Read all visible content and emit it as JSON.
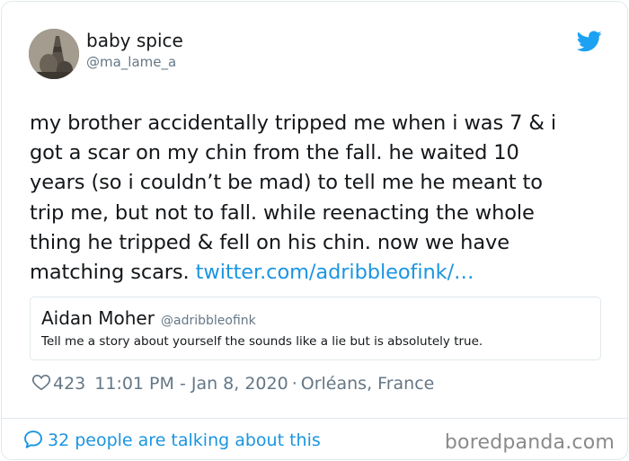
{
  "colors": {
    "twitter_blue": "#1da1f2",
    "link_blue": "#1b95e0",
    "secondary_text": "#657786",
    "border": "#e1e8ed"
  },
  "author": {
    "display_name": "baby spice",
    "handle": "@ma_lame_a",
    "avatar_icon": "avatar-photo",
    "platform_icon": "twitter-bird-icon"
  },
  "tweet": {
    "lines": [
      "my brother accidentally tripped me when i was 7 & i",
      "got a scar on my chin from the fall. he waited 10",
      "years (so i couldn’t be mad) to tell me he meant to",
      "trip me, but not to fall. while reenacting the whole",
      "thing he tripped & fell on his chin. now we have",
      "matching scars. "
    ],
    "link": "twitter.com/adribbleofink/…"
  },
  "quote": {
    "display_name": "Aidan Moher",
    "handle": "@adribbleofink",
    "text": "Tell me a story about yourself the sounds like a lie but is absolutely true."
  },
  "meta": {
    "like_icon": "heart-icon",
    "like_count": "423",
    "timestamp": "11:01 PM - Jan 8, 2020",
    "separator": "·",
    "location": "Orléans, France"
  },
  "footer": {
    "bubble_icon": "speech-bubble-icon",
    "talking_text": "32 people are talking about this",
    "watermark": "boredpanda.com"
  }
}
